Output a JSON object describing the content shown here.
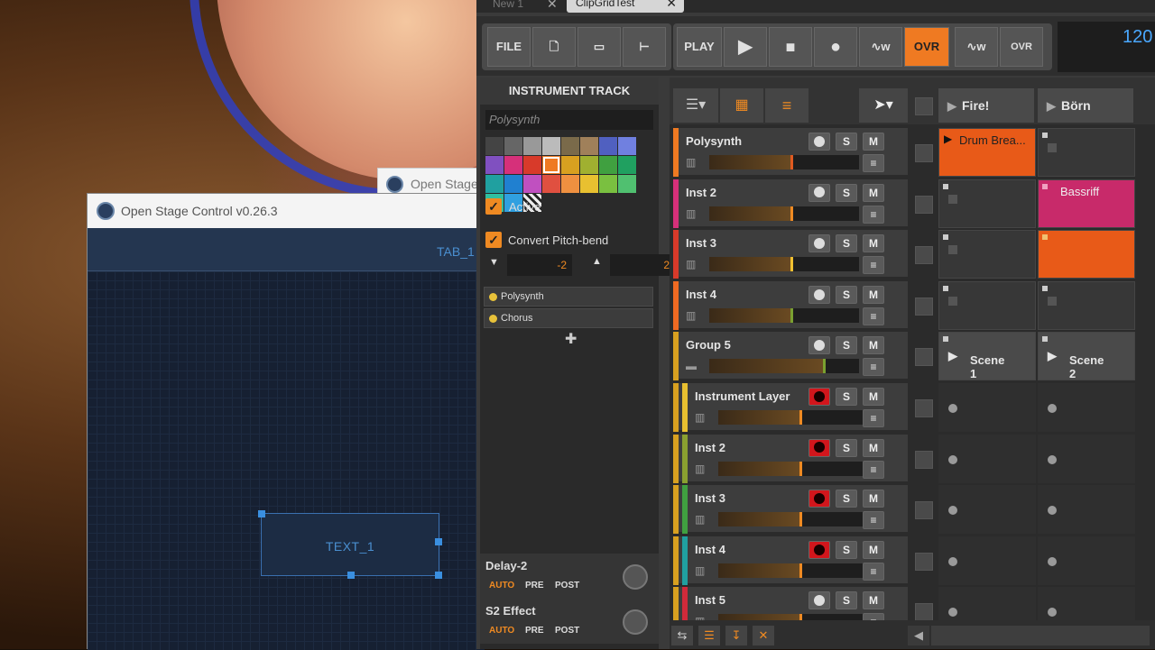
{
  "osc": {
    "back_title": "Open Stage",
    "title": "Open Stage Control v0.26.3",
    "tab": "TAB_1",
    "widget": "TEXT_1"
  },
  "bitwig": {
    "tabs": [
      {
        "label": "New 1"
      },
      {
        "label": "ClipGridTest"
      }
    ],
    "toolbar": {
      "file": "FILE",
      "play": "PLAY",
      "ovr": "OVR",
      "ovr2": "OVR",
      "tempo": "120"
    },
    "inspector": {
      "header": "INSTRUMENT TRACK",
      "name_placeholder": "Polysynth",
      "active": "Active",
      "convert": "Convert Pitch-bend",
      "bend_down": "-2",
      "bend_up": "2",
      "devices": [
        "Polysynth",
        "Chorus"
      ],
      "sends": [
        {
          "name": "Delay-2",
          "auto": "AUTO",
          "pre": "PRE",
          "post": "POST"
        },
        {
          "name": "S2 Effect",
          "auto": "AUTO",
          "pre": "PRE",
          "post": "POST"
        }
      ]
    },
    "scenes": [
      "Fire!",
      "Börn"
    ],
    "tracks": [
      {
        "name": "Polysynth",
        "color": "#ef7a22",
        "level": 0.54,
        "meter": "#e05a20"
      },
      {
        "name": "Inst 2",
        "color": "#d6307a",
        "level": 0.54,
        "meter": "#ef8a22"
      },
      {
        "name": "Inst 3",
        "color": "#d83a2a",
        "level": 0.54,
        "meter": "#f0c030"
      },
      {
        "name": "Inst 4",
        "color": "#ef6a22",
        "level": 0.54,
        "meter": "#7aa030"
      },
      {
        "name": "Group 5",
        "color": "#d8a020",
        "level": 0.76,
        "meter": "#7aa030"
      },
      {
        "name": "Instrument Layer",
        "color": "#e8c030",
        "level": 0.54,
        "meter": "#ef8a22"
      },
      {
        "name": "Inst 2",
        "color": "#8aa030",
        "level": 0.54,
        "meter": "#ef8a22"
      },
      {
        "name": "Inst 3",
        "color": "#40a040",
        "level": 0.54,
        "meter": "#ef8a22"
      },
      {
        "name": "Inst 4",
        "color": "#20a0a0",
        "level": 0.54,
        "meter": "#ef8a22"
      },
      {
        "name": "Inst 5",
        "color": "#d02a3a",
        "level": 0.54,
        "meter": "#ef8a22"
      }
    ],
    "clips": {
      "r0c0": "Drum Brea...",
      "r1c1": "Bassriff",
      "r4c0": "Scene 1",
      "r4c1": "Scene 2"
    },
    "btn": {
      "s": "S",
      "m": "M"
    }
  }
}
